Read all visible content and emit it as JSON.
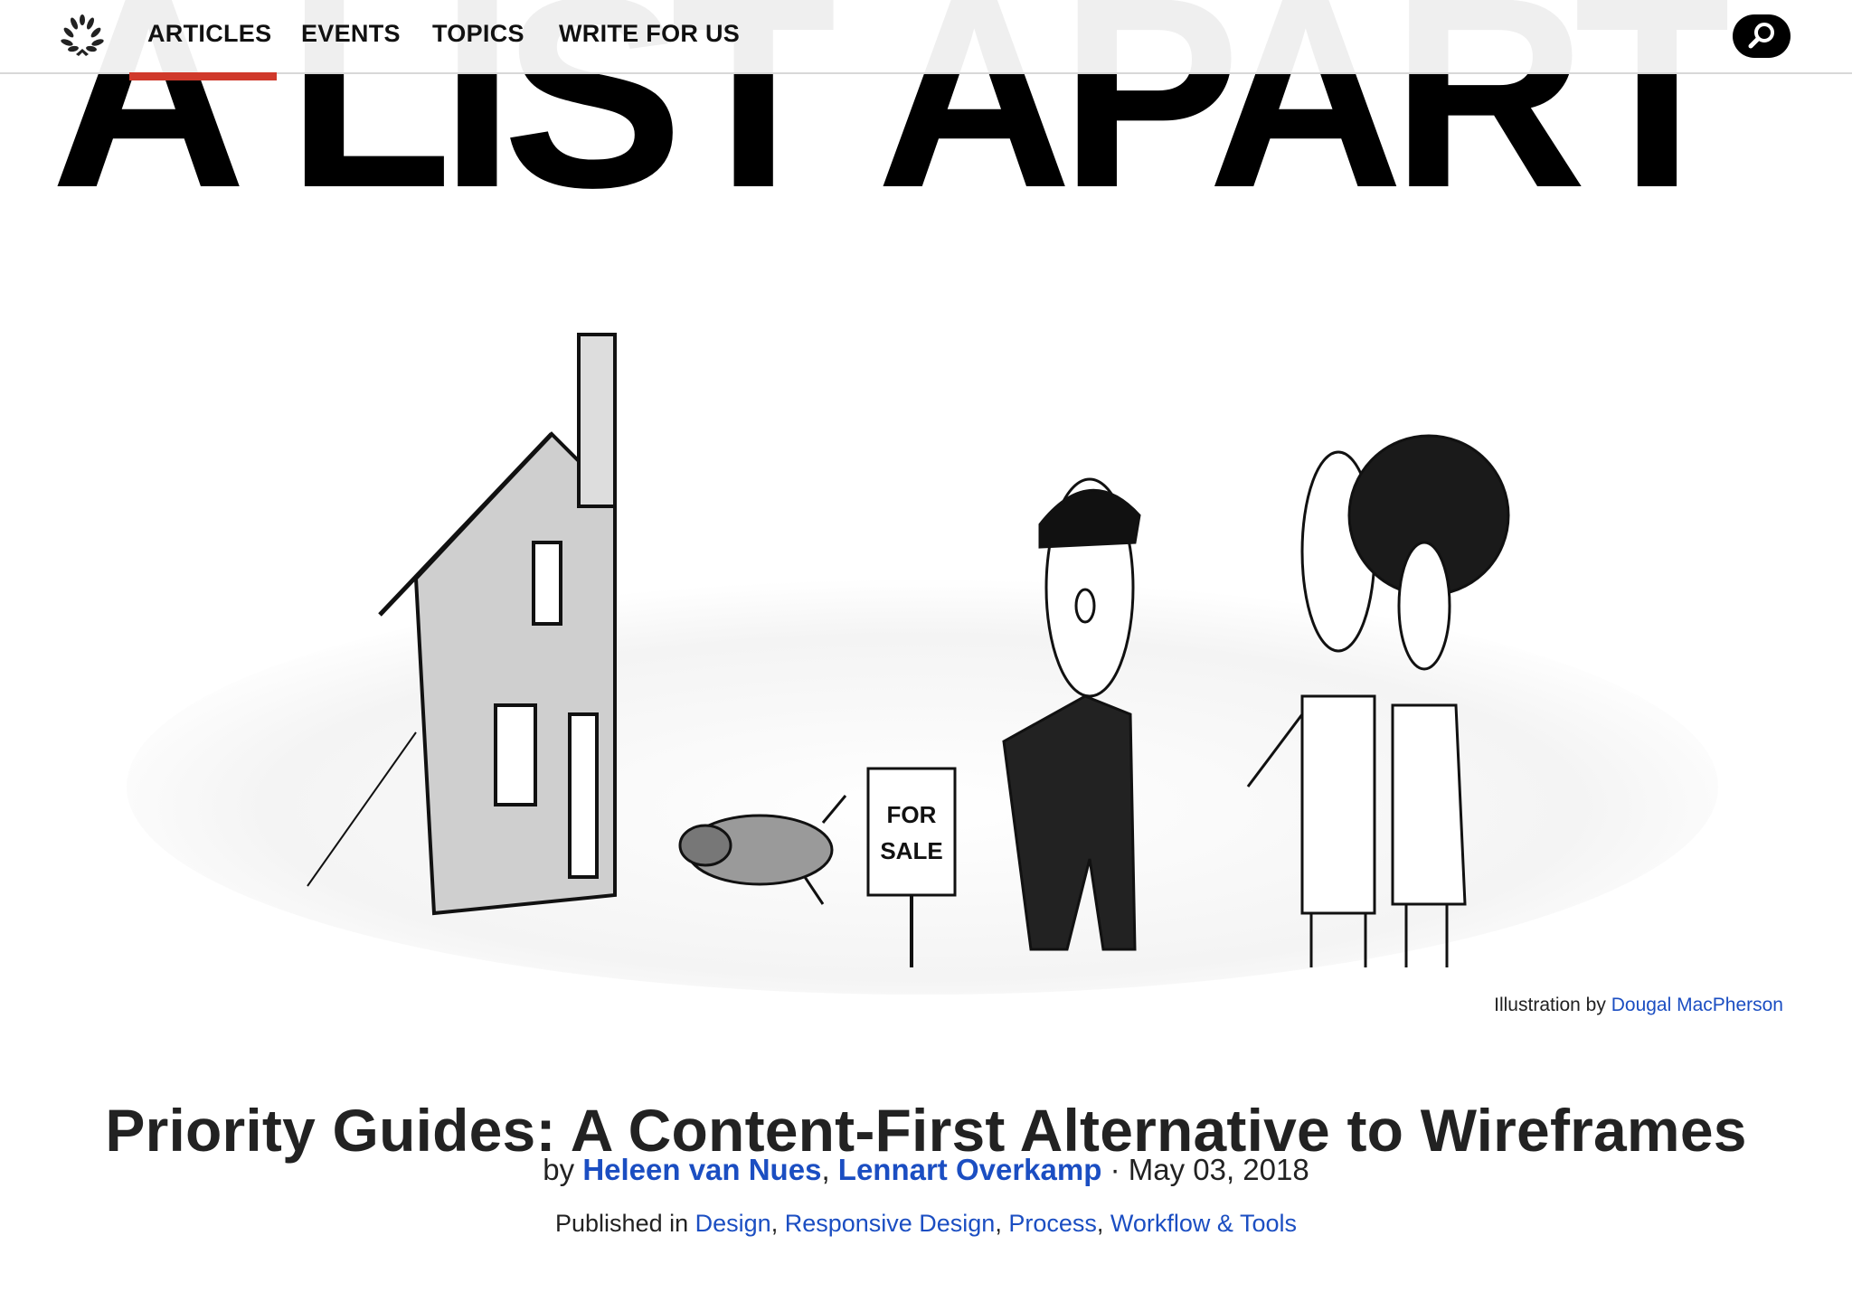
{
  "site": {
    "masthead": "A LIST APART"
  },
  "nav": {
    "items": [
      {
        "label": "ARTICLES",
        "active": true
      },
      {
        "label": "EVENTS",
        "active": false
      },
      {
        "label": "TOPICS",
        "active": false
      },
      {
        "label": "WRITE FOR US",
        "active": false
      }
    ],
    "accent_color": "#d0392b"
  },
  "hero": {
    "sign_text_line1": "FOR",
    "sign_text_line2": "SALE",
    "credit_prefix": "Illustration by",
    "credit_name": "Dougal MacPherson"
  },
  "article": {
    "title": "Priority Guides: A Content-First Alternative to Wireframes",
    "by_prefix": "by",
    "authors": [
      "Heleen van Nues",
      "Lennart Overkamp"
    ],
    "author_separator": ",",
    "date_separator": "·",
    "date": "May 03, 2018",
    "published_prefix": "Published in",
    "categories": [
      "Design",
      "Responsive Design",
      "Process",
      "Workflow & Tools"
    ],
    "link_color": "#1b4ec2"
  }
}
